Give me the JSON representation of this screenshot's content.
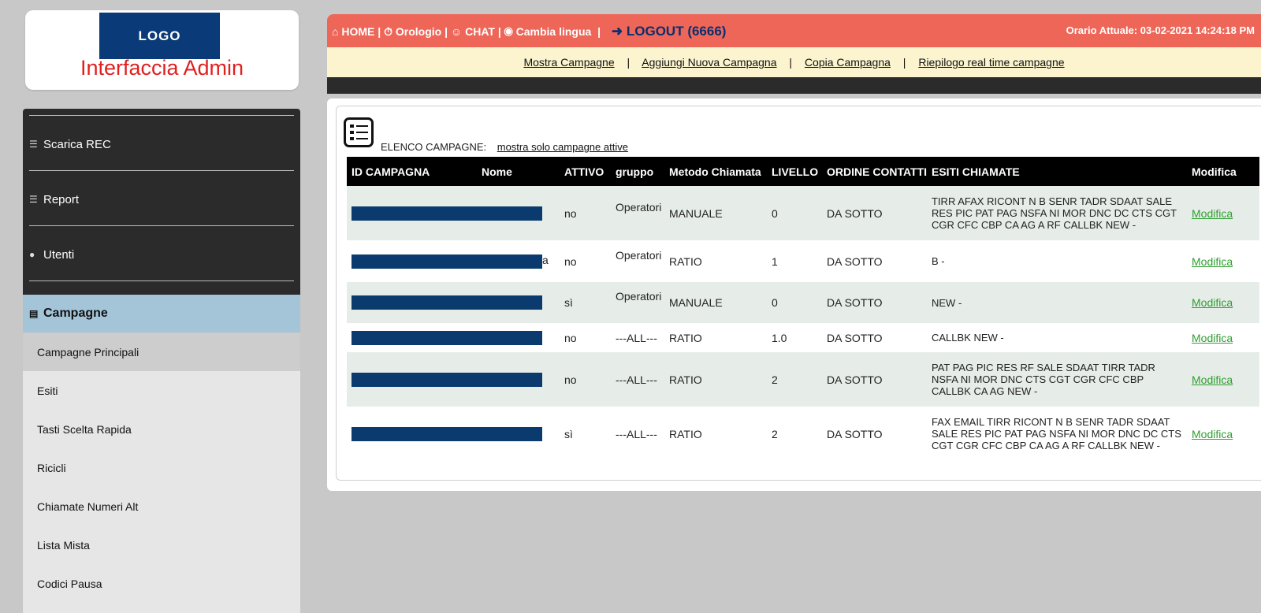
{
  "logo": {
    "mark": "LOGO",
    "title": "Interfaccia Admin"
  },
  "topbar": {
    "home": "HOME",
    "clock": "Orologio",
    "chat": "CHAT",
    "lang": "Cambia lingua",
    "logout": "LOGOUT (6666)",
    "time_label": "Orario Attuale: 03-02-2021 14:24:18 PM"
  },
  "subnav": {
    "items": [
      "Mostra Campagne",
      "Aggiungi Nuova Campagna",
      "Copia Campagna",
      "Riepilogo real time campagne"
    ]
  },
  "sidebar": {
    "items": [
      {
        "label": "Scarica REC",
        "icon": "bars-icon"
      },
      {
        "label": "Report",
        "icon": "bars-icon"
      },
      {
        "label": "Utenti",
        "icon": "users-icon"
      }
    ],
    "active": "Campagne",
    "submenu": [
      "Campagne Principali",
      "Esiti",
      "Tasti Scelta Rapida",
      "Ricicli",
      "Chiamate Numeri Alt",
      "Lista Mista",
      "Codici Pausa"
    ]
  },
  "list": {
    "title": "ELENCO CAMPAGNE:",
    "filter_link": "mostra solo campagne attive",
    "headers": [
      "ID CAMPAGNA",
      "Nome",
      "ATTIVO",
      "gruppo",
      "Metodo Chiamata",
      "LIVELLO",
      "ORDINE CONTATTI",
      "ESITI CHIAMATE",
      "Modifica"
    ],
    "rows": [
      {
        "suffix": "",
        "attivo": "no",
        "gruppo": "Operatori",
        "metodo": "MANUALE",
        "livello": "0",
        "ordine": "DA SOTTO",
        "esiti": "TIRR AFAX RICONT N B SENR TADR SDAAT SALE RES PIC PAT PAG NSFA NI MOR DNC DC CTS CGT CGR CFC CBP CA AG A RF CALLBK NEW -",
        "modifica": "Modifica"
      },
      {
        "suffix": "a",
        "attivo": "no",
        "gruppo": "Operatori",
        "metodo": "RATIO",
        "livello": "1",
        "ordine": "DA SOTTO",
        "esiti": "B -",
        "modifica": "Modifica"
      },
      {
        "suffix": "",
        "attivo": "sì",
        "gruppo": "Operatori",
        "metodo": "MANUALE",
        "livello": "0",
        "ordine": "DA SOTTO",
        "esiti": "NEW -",
        "modifica": "Modifica"
      },
      {
        "suffix": "",
        "attivo": "no",
        "gruppo": "---ALL---",
        "metodo": "RATIO",
        "livello": "1.0",
        "ordine": "DA SOTTO",
        "esiti": "CALLBK NEW -",
        "modifica": "Modifica"
      },
      {
        "suffix": "",
        "attivo": "no",
        "gruppo": "---ALL---",
        "metodo": "RATIO",
        "livello": "2",
        "ordine": "DA SOTTO",
        "esiti": "PAT PAG PIC RES RF SALE SDAAT TIRR TADR NSFA NI MOR DNC CTS CGT CGR CFC CBP CALLBK CA AG NEW -",
        "modifica": "Modifica"
      },
      {
        "suffix": "",
        "attivo": "sì",
        "gruppo": "---ALL---",
        "metodo": "RATIO",
        "livello": "2",
        "ordine": "DA SOTTO",
        "esiti": "FAX EMAIL TIRR RICONT N B SENR TADR SDAAT SALE RES PIC PAT PAG NSFA NI MOR DNC DC CTS CGT CGR CFC CBP CA AG A RF CALLBK NEW -",
        "modifica": "Modifica"
      }
    ]
  },
  "colors": {
    "topbar": "#ee6658",
    "subnav": "#fbf4cf",
    "active": "#a4c4d8",
    "redacted": "#0a3a6e",
    "link_green": "#2e9e2e"
  }
}
